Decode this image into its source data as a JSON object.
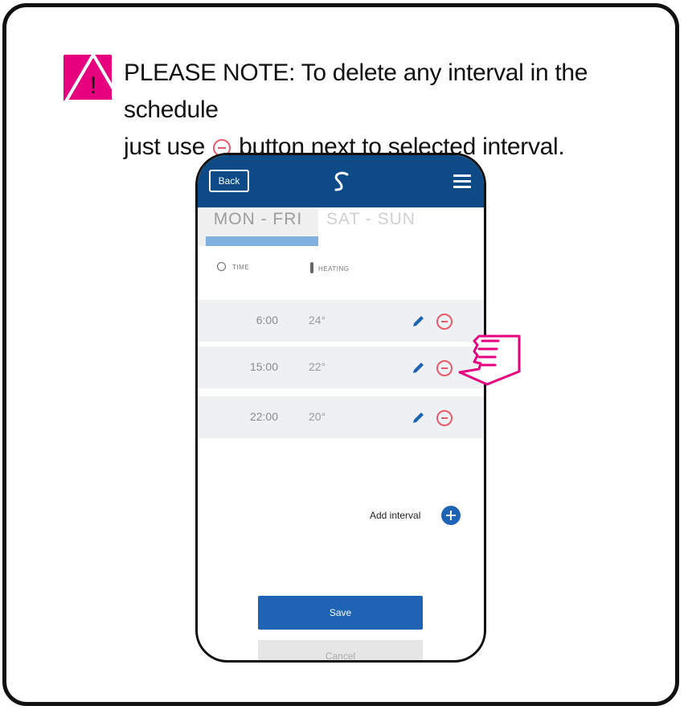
{
  "note": {
    "line1": "PLEASE NOTE: To delete any interval in the schedule",
    "line2_before": "just use",
    "line2_after": "button next to selected interval.",
    "warning_icon": "warning-triangle-icon",
    "accent_color": "#e6007e"
  },
  "app": {
    "back_label": "Back",
    "logo_icon": "salus-logo-icon",
    "menu_icon": "hamburger-menu-icon",
    "header_color": "#0d4a86",
    "tabs": [
      {
        "label": "MON - FRI",
        "active": true
      },
      {
        "label": "SAT - SUN",
        "active": false
      }
    ],
    "columns": {
      "time": "TIME",
      "heating": "HEATING"
    },
    "intervals": [
      {
        "time": "6:00",
        "temp": "24°"
      },
      {
        "time": "15:00",
        "temp": "22°"
      },
      {
        "time": "22:00",
        "temp": "20°"
      }
    ],
    "add_interval_label": "Add interval",
    "save_label": "Save",
    "cancel_label": "Cancel",
    "primary_color": "#1f63b4",
    "delete_color": "#e85a6b"
  }
}
